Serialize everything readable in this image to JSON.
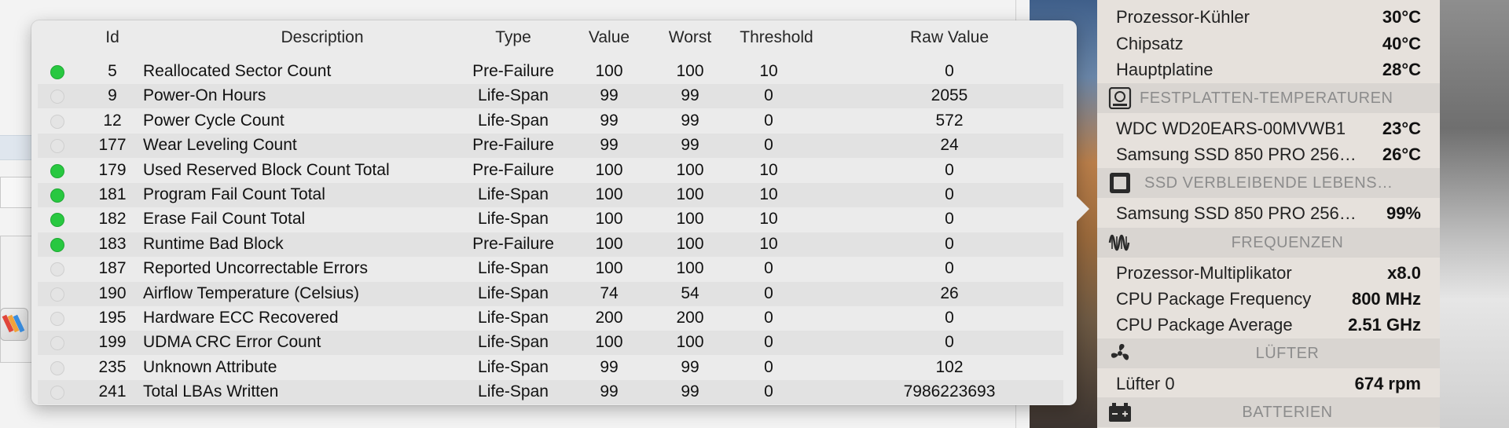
{
  "smart_table": {
    "columns": {
      "id": "Id",
      "description": "Description",
      "type": "Type",
      "value": "Value",
      "worst": "Worst",
      "threshold": "Threshold",
      "raw_value": "Raw Value"
    },
    "rows": [
      {
        "status": "green",
        "id": "5",
        "description": "Reallocated Sector Count",
        "type": "Pre-Failure",
        "value": "100",
        "worst": "100",
        "threshold": "10",
        "raw": "0"
      },
      {
        "status": "grey",
        "id": "9",
        "description": "Power-On Hours",
        "type": "Life-Span",
        "value": "99",
        "worst": "99",
        "threshold": "0",
        "raw": "2055"
      },
      {
        "status": "grey",
        "id": "12",
        "description": "Power Cycle Count",
        "type": "Life-Span",
        "value": "99",
        "worst": "99",
        "threshold": "0",
        "raw": "572"
      },
      {
        "status": "grey",
        "id": "177",
        "description": "Wear Leveling Count",
        "type": "Pre-Failure",
        "value": "99",
        "worst": "99",
        "threshold": "0",
        "raw": "24"
      },
      {
        "status": "green",
        "id": "179",
        "description": "Used Reserved Block Count Total",
        "type": "Pre-Failure",
        "value": "100",
        "worst": "100",
        "threshold": "10",
        "raw": "0"
      },
      {
        "status": "green",
        "id": "181",
        "description": "Program Fail Count Total",
        "type": "Life-Span",
        "value": "100",
        "worst": "100",
        "threshold": "10",
        "raw": "0"
      },
      {
        "status": "green",
        "id": "182",
        "description": "Erase Fail Count Total",
        "type": "Life-Span",
        "value": "100",
        "worst": "100",
        "threshold": "10",
        "raw": "0"
      },
      {
        "status": "green",
        "id": "183",
        "description": "Runtime Bad Block",
        "type": "Pre-Failure",
        "value": "100",
        "worst": "100",
        "threshold": "10",
        "raw": "0"
      },
      {
        "status": "grey",
        "id": "187",
        "description": "Reported Uncorrectable Errors",
        "type": "Life-Span",
        "value": "100",
        "worst": "100",
        "threshold": "0",
        "raw": "0"
      },
      {
        "status": "grey",
        "id": "190",
        "description": "Airflow Temperature (Celsius)",
        "type": "Life-Span",
        "value": "74",
        "worst": "54",
        "threshold": "0",
        "raw": "26"
      },
      {
        "status": "grey",
        "id": "195",
        "description": "Hardware ECC Recovered",
        "type": "Life-Span",
        "value": "200",
        "worst": "200",
        "threshold": "0",
        "raw": "0"
      },
      {
        "status": "grey",
        "id": "199",
        "description": "UDMA CRC Error Count",
        "type": "Life-Span",
        "value": "100",
        "worst": "100",
        "threshold": "0",
        "raw": "0"
      },
      {
        "status": "grey",
        "id": "235",
        "description": "Unknown Attribute",
        "type": "Life-Span",
        "value": "99",
        "worst": "99",
        "threshold": "0",
        "raw": "102"
      },
      {
        "status": "grey",
        "id": "241",
        "description": "Total LBAs Written",
        "type": "Life-Span",
        "value": "99",
        "worst": "99",
        "threshold": "0",
        "raw": "7986223693"
      }
    ]
  },
  "sensors": {
    "top_rows": [
      {
        "label": "Prozessor-Kühler",
        "value": "30°C"
      },
      {
        "label": "Chipsatz",
        "value": "40°C"
      },
      {
        "label": "Hauptplatine",
        "value": "28°C"
      }
    ],
    "disk_temps": {
      "title": "FESTPLATTEN-TEMPERATUREN",
      "icon": "hard-disk-icon",
      "rows": [
        {
          "label": "WDC WD20EARS-00MVWB1",
          "value": "23°C"
        },
        {
          "label": "Samsung SSD 850 PRO 256…",
          "value": "26°C"
        }
      ]
    },
    "ssd_life": {
      "title": "SSD VERBLEIBENDE LEBENS…",
      "icon": "ssd-icon",
      "rows": [
        {
          "label": "Samsung SSD 850 PRO 256…",
          "value": "99%"
        }
      ]
    },
    "frequencies": {
      "title": "FREQUENZEN",
      "icon": "frequency-wave-icon",
      "rows": [
        {
          "label": "Prozessor-Multiplikator",
          "value": "x8.0"
        },
        {
          "label": "CPU Package Frequency",
          "value": "800 MHz"
        },
        {
          "label": "CPU Package Average",
          "value": "2.51 GHz"
        }
      ]
    },
    "fans": {
      "title": "LÜFTER",
      "icon": "fan-icon",
      "rows": [
        {
          "label": "Lüfter 0",
          "value": "674 rpm"
        }
      ]
    },
    "batteries": {
      "title": "BATTERIEN",
      "icon": "battery-icon"
    }
  },
  "colors": {
    "status_ok": "#28c840",
    "status_idle": "#e4e4e4"
  }
}
